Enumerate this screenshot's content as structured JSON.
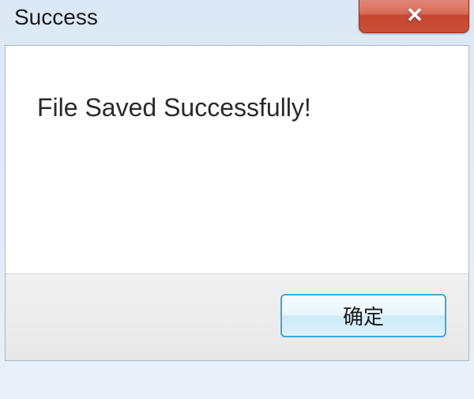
{
  "dialog": {
    "title": "Success",
    "message": "File Saved Successfully!",
    "ok_button_label": "确定"
  }
}
